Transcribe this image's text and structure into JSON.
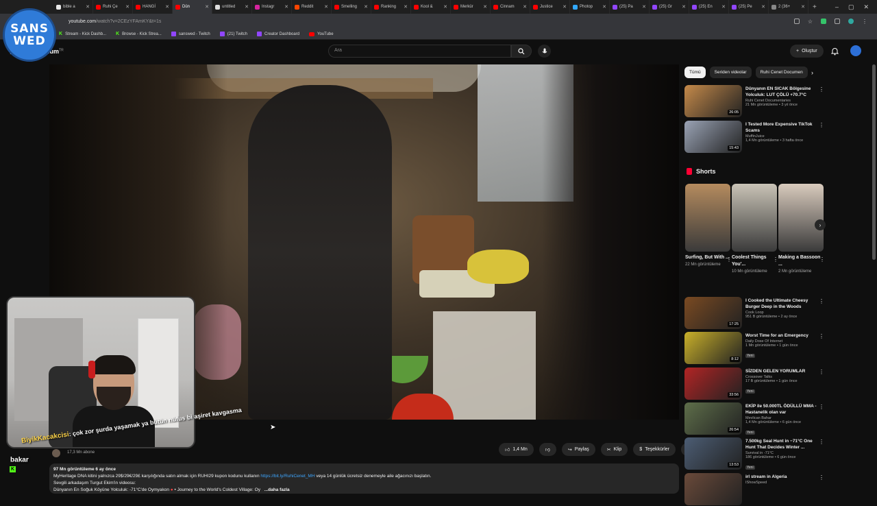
{
  "browser": {
    "tabs": [
      {
        "label": "bible a",
        "color": "#e8e8e8"
      },
      {
        "label": "Ruhi Çe",
        "color": "#ff0000"
      },
      {
        "label": "HANGİ",
        "color": "#ff0000"
      },
      {
        "label": "Dün",
        "color": "#ff0000",
        "active": true
      },
      {
        "label": "untitled",
        "color": "#dddddd"
      },
      {
        "label": "Instagr",
        "color": "#d6249f"
      },
      {
        "label": "Reddit",
        "color": "#ff4500"
      },
      {
        "label": "Smelling",
        "color": "#ff0000"
      },
      {
        "label": "Ranking",
        "color": "#ff0000"
      },
      {
        "label": "Kool &",
        "color": "#ff0000"
      },
      {
        "label": "Merkür",
        "color": "#ff0000"
      },
      {
        "label": "Cinnam",
        "color": "#ff0000"
      },
      {
        "label": "Justice",
        "color": "#ff0000"
      },
      {
        "label": "Photop",
        "color": "#31a8ff"
      },
      {
        "label": "(25) Pa",
        "color": "#9146ff"
      },
      {
        "label": "(25) Gr",
        "color": "#9146ff"
      },
      {
        "label": "(25) En",
        "color": "#9146ff"
      },
      {
        "label": "(25) Pe",
        "color": "#9146ff"
      },
      {
        "label": "2 (36+",
        "color": "#888888"
      }
    ],
    "new_tab": "+",
    "url_host": "youtube.com",
    "url_path": "/watch?v=2CEzYFAmKY&t=1s",
    "bookmarks": [
      {
        "label": "Stream - Kick Dashb...",
        "icon": "kick"
      },
      {
        "label": "Browse - Kick Strea...",
        "icon": "kick"
      },
      {
        "label": "sanswed - Twitch",
        "icon": "twitch"
      },
      {
        "label": "(21) Twitch",
        "icon": "twitch"
      },
      {
        "label": "Creator Dashboard",
        "icon": "twitch"
      },
      {
        "label": "YouTube",
        "icon": "youtube"
      }
    ]
  },
  "overlay": {
    "logo_line1": "SANS",
    "logo_line2": "WED",
    "chat_user": "BiyikKacakcisi",
    "chat_message": ": çok zor şurda yaşamak ya bütün nüfus bi aşiret kavgasma",
    "chat_tail": "bakar"
  },
  "youtube": {
    "logo_suffix": "TR",
    "search_placeholder": "Ara",
    "create_label": "Oluştur",
    "subscribers": "17,3 Mn abone",
    "actions": {
      "like_count": "1,4 Mn",
      "share": "Paylaş",
      "clip": "Klip",
      "thanks": "Teşekkürler"
    },
    "description": {
      "meta": "97 Mn görüntüleme  6 ay önce",
      "line1": "MyHeritage DNA kitini yalnızca 29$/29€/29£ karşılığında satın almak için RUHI29 kupon kodunu kullanın",
      "link": "https://bit.ly/RuhiCenet_MH",
      "line1_tail": "veya 14 günlük ücretsiz denemeyle aile ağacınızı başlatın.",
      "line2": "Sevgili arkadaşım Turgut Ekim'in videosu:",
      "line3": "Dünyanın En Soğuk Köyüne Yolculuk: -71°C'de Oymyakon",
      "line3_b": "• Journey to the World's Coldest Village: Oy",
      "more": "...daha fazla"
    }
  },
  "sidebar": {
    "chips": [
      "Tümü",
      "Seriden videolar",
      "Ruhi Cenet Documen"
    ],
    "shorts_title": "Shorts",
    "recommended_top": [
      {
        "title": "Dünyanın EN SICAK Bölgesine Yolculuk: LUT ÇÖLÜ +70.7°C",
        "channel": "Ruhi Cenet Documentaries",
        "meta": "21 Mn görüntüleme • 3 yıl önce",
        "duration": "26:05",
        "thumb": "#c58a4a"
      },
      {
        "title": "I Tested More Expensive TikTok Scams",
        "channel": "MuffinJuice",
        "meta": "1,4 Mn görüntüleme • 3 hafta önce",
        "duration": "15:43",
        "thumb": "#9aa3b5"
      }
    ],
    "shorts": [
      {
        "title": "Surfing, But With ...",
        "views": "22 Mn görüntüleme",
        "thumb": "#b58b5e"
      },
      {
        "title": "Coolest Things You'...",
        "views": "10 Mn görüntüleme",
        "thumb": "#c9c3b6"
      },
      {
        "title": "Making a Bassoon ...",
        "views": "2 Mn görüntüleme",
        "thumb": "#d9cbbd"
      }
    ],
    "recommended": [
      {
        "title": "I Cooked the Ultimate Cheesy Burger Deep in the Woods",
        "channel": "Cook Loop",
        "meta": "951 B görüntüleme • 2 ay önce",
        "duration": "17:25",
        "thumb": "#7a4a22",
        "new": ""
      },
      {
        "title": "Worst Time for an Emergency",
        "channel": "Daily Dose Of Internet",
        "meta": "1 Mn görüntüleme • 1 gün önce",
        "duration": "8:12",
        "thumb": "#c9b02a",
        "new": "Yeni"
      },
      {
        "title": "SİZDEN GELEN YORUMLAR",
        "channel": "Crossover Talks",
        "meta": "17 B görüntüleme • 1 gün önce",
        "duration": "33:56",
        "thumb": "#b22424",
        "new": "Yeni"
      },
      {
        "title": "EKİP ile 50.000TL ÖDÜLLÜ MMA - Hastanelik olan var",
        "channel": "Mevlican Bahar",
        "meta": "1,4 Mn görüntüleme • 6 gün önce",
        "duration": "26:54",
        "thumb": "#5e6e4a",
        "new": "Yeni"
      },
      {
        "title": "7.500kg Seal Hunt in −71°C One Hunt That Decides Winter ...",
        "channel": "Survival in -71°C",
        "meta": "186 görüntüleme • 6 gün önce",
        "duration": "13:53",
        "thumb": "#4c5d74",
        "new": "Yeni"
      },
      {
        "title": "irl stream in Algeria",
        "channel": "IShowSpeed",
        "meta": "",
        "duration": "",
        "thumb": "#6a4a3a",
        "new": ""
      }
    ]
  },
  "colors": {
    "accent": "#3ea6ff",
    "brand": "#ff0000",
    "kick": "#53fc18",
    "twitch": "#9146ff"
  }
}
